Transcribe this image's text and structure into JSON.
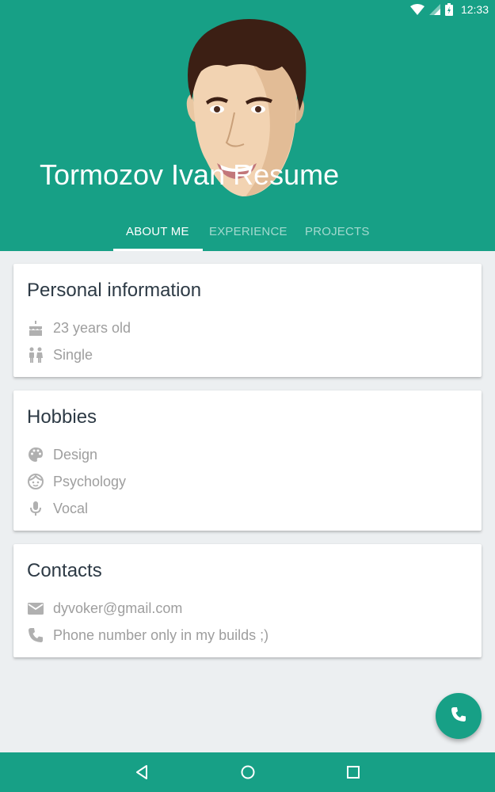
{
  "status_bar": {
    "time": "12:33"
  },
  "header": {
    "title": "Tormozov Ivan Resume"
  },
  "tabs": [
    {
      "label": "ABOUT ME",
      "active": true
    },
    {
      "label": "EXPERIENCE",
      "active": false
    },
    {
      "label": "PROJECTS",
      "active": false
    }
  ],
  "cards": [
    {
      "title": "Personal information",
      "items": [
        {
          "icon": "cake-icon",
          "text": "23 years old"
        },
        {
          "icon": "people-icon",
          "text": "Single"
        }
      ]
    },
    {
      "title": "Hobbies",
      "items": [
        {
          "icon": "palette-icon",
          "text": "Design"
        },
        {
          "icon": "face-icon",
          "text": "Psychology"
        },
        {
          "icon": "microphone-icon",
          "text": "Vocal"
        }
      ]
    },
    {
      "title": "Contacts",
      "items": [
        {
          "icon": "email-icon",
          "text": "dyvoker@gmail.com"
        },
        {
          "icon": "phone-icon",
          "text": "Phone number only in my builds ;)"
        }
      ]
    }
  ],
  "fab": {
    "icon": "phone-icon"
  },
  "nav_bar": {
    "buttons": [
      "back-icon",
      "home-icon",
      "recents-icon"
    ]
  },
  "colors": {
    "primary": "#17A086",
    "background": "#ECEFF1",
    "title_text": "#2D3A45",
    "secondary_text": "#9E9E9E"
  }
}
